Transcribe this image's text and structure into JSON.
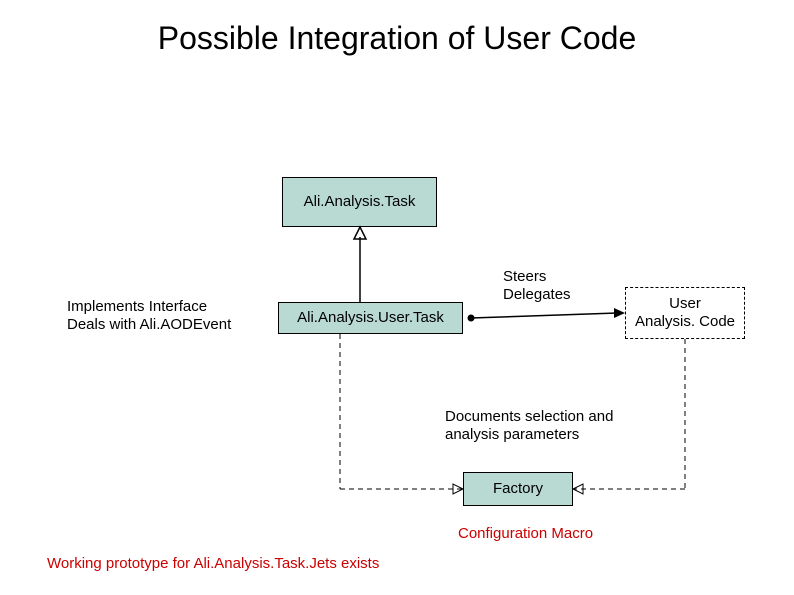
{
  "title": "Possible Integration of User Code",
  "boxes": {
    "analysis_task": "Ali.Analysis.Task",
    "analysis_user_task": "Ali.Analysis.User.Task",
    "user_code": "User\nAnalysis. Code",
    "factory": "Factory"
  },
  "annotations": {
    "implements": "Implements Interface\nDeals with Ali.AODEvent",
    "steers": "Steers\nDelegates",
    "documents": "Documents selection and\nanalysis parameters",
    "config_macro": "Configuration Macro",
    "prototype": "Working prototype for Ali.Analysis.Task.Jets exists"
  }
}
